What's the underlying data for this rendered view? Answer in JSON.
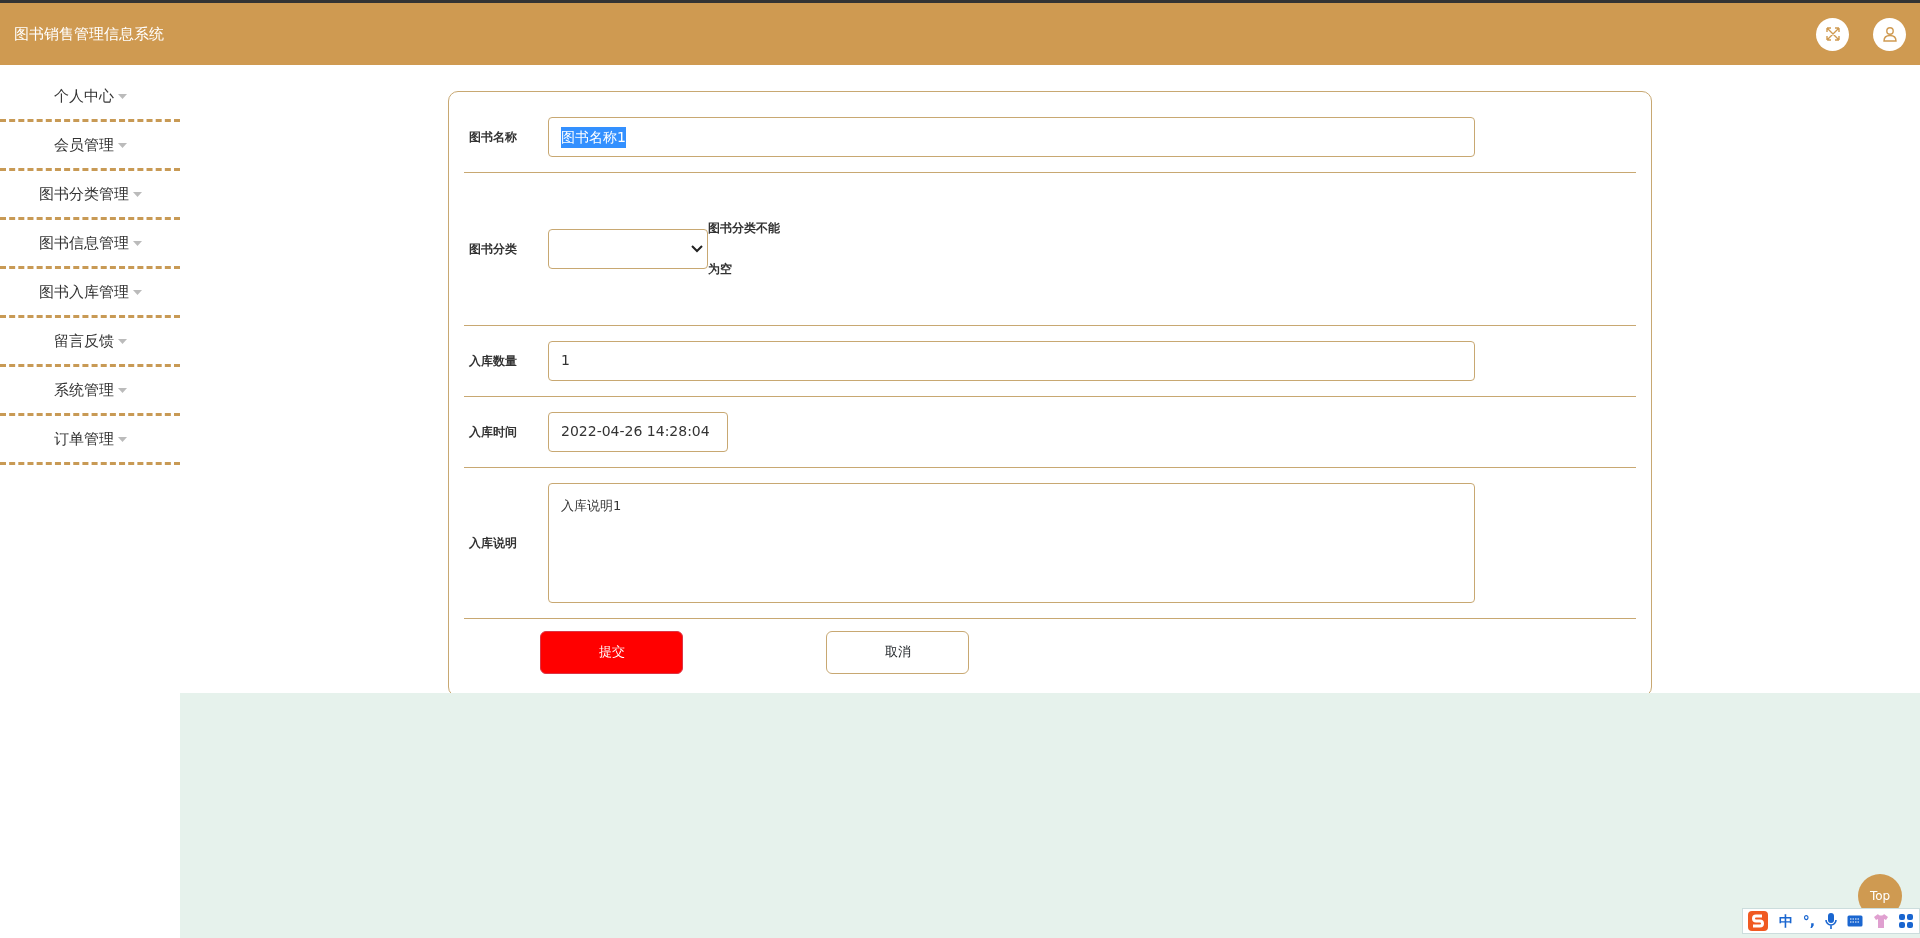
{
  "header": {
    "title": "图书销售管理信息系统"
  },
  "sidebar": {
    "items": [
      {
        "label": "个人中心"
      },
      {
        "label": "会员管理"
      },
      {
        "label": "图书分类管理"
      },
      {
        "label": "图书信息管理"
      },
      {
        "label": "图书入库管理"
      },
      {
        "label": "留言反馈"
      },
      {
        "label": "系统管理"
      },
      {
        "label": "订单管理"
      }
    ]
  },
  "form": {
    "fields": [
      {
        "kind": "text",
        "label": "图书名称",
        "value": "图书名称1",
        "text_selected": true
      },
      {
        "kind": "select",
        "label": "图书分类",
        "error": "图书分类不能为空"
      },
      {
        "kind": "text",
        "label": "入库数量",
        "value": "1",
        "text_selected": false
      },
      {
        "kind": "datetime",
        "label": "入库时间",
        "value": "2022-04-26 14:28:04"
      },
      {
        "kind": "textarea",
        "label": "入库说明",
        "value": "入库说明1"
      }
    ],
    "buttons": [
      {
        "kind": "primary",
        "label": "提交"
      },
      {
        "kind": "outline",
        "label": "取消"
      }
    ]
  },
  "back_to_top": {
    "label": "Top"
  },
  "ime_toolbar": {
    "mode": "中",
    "punctuation": "°,"
  }
}
